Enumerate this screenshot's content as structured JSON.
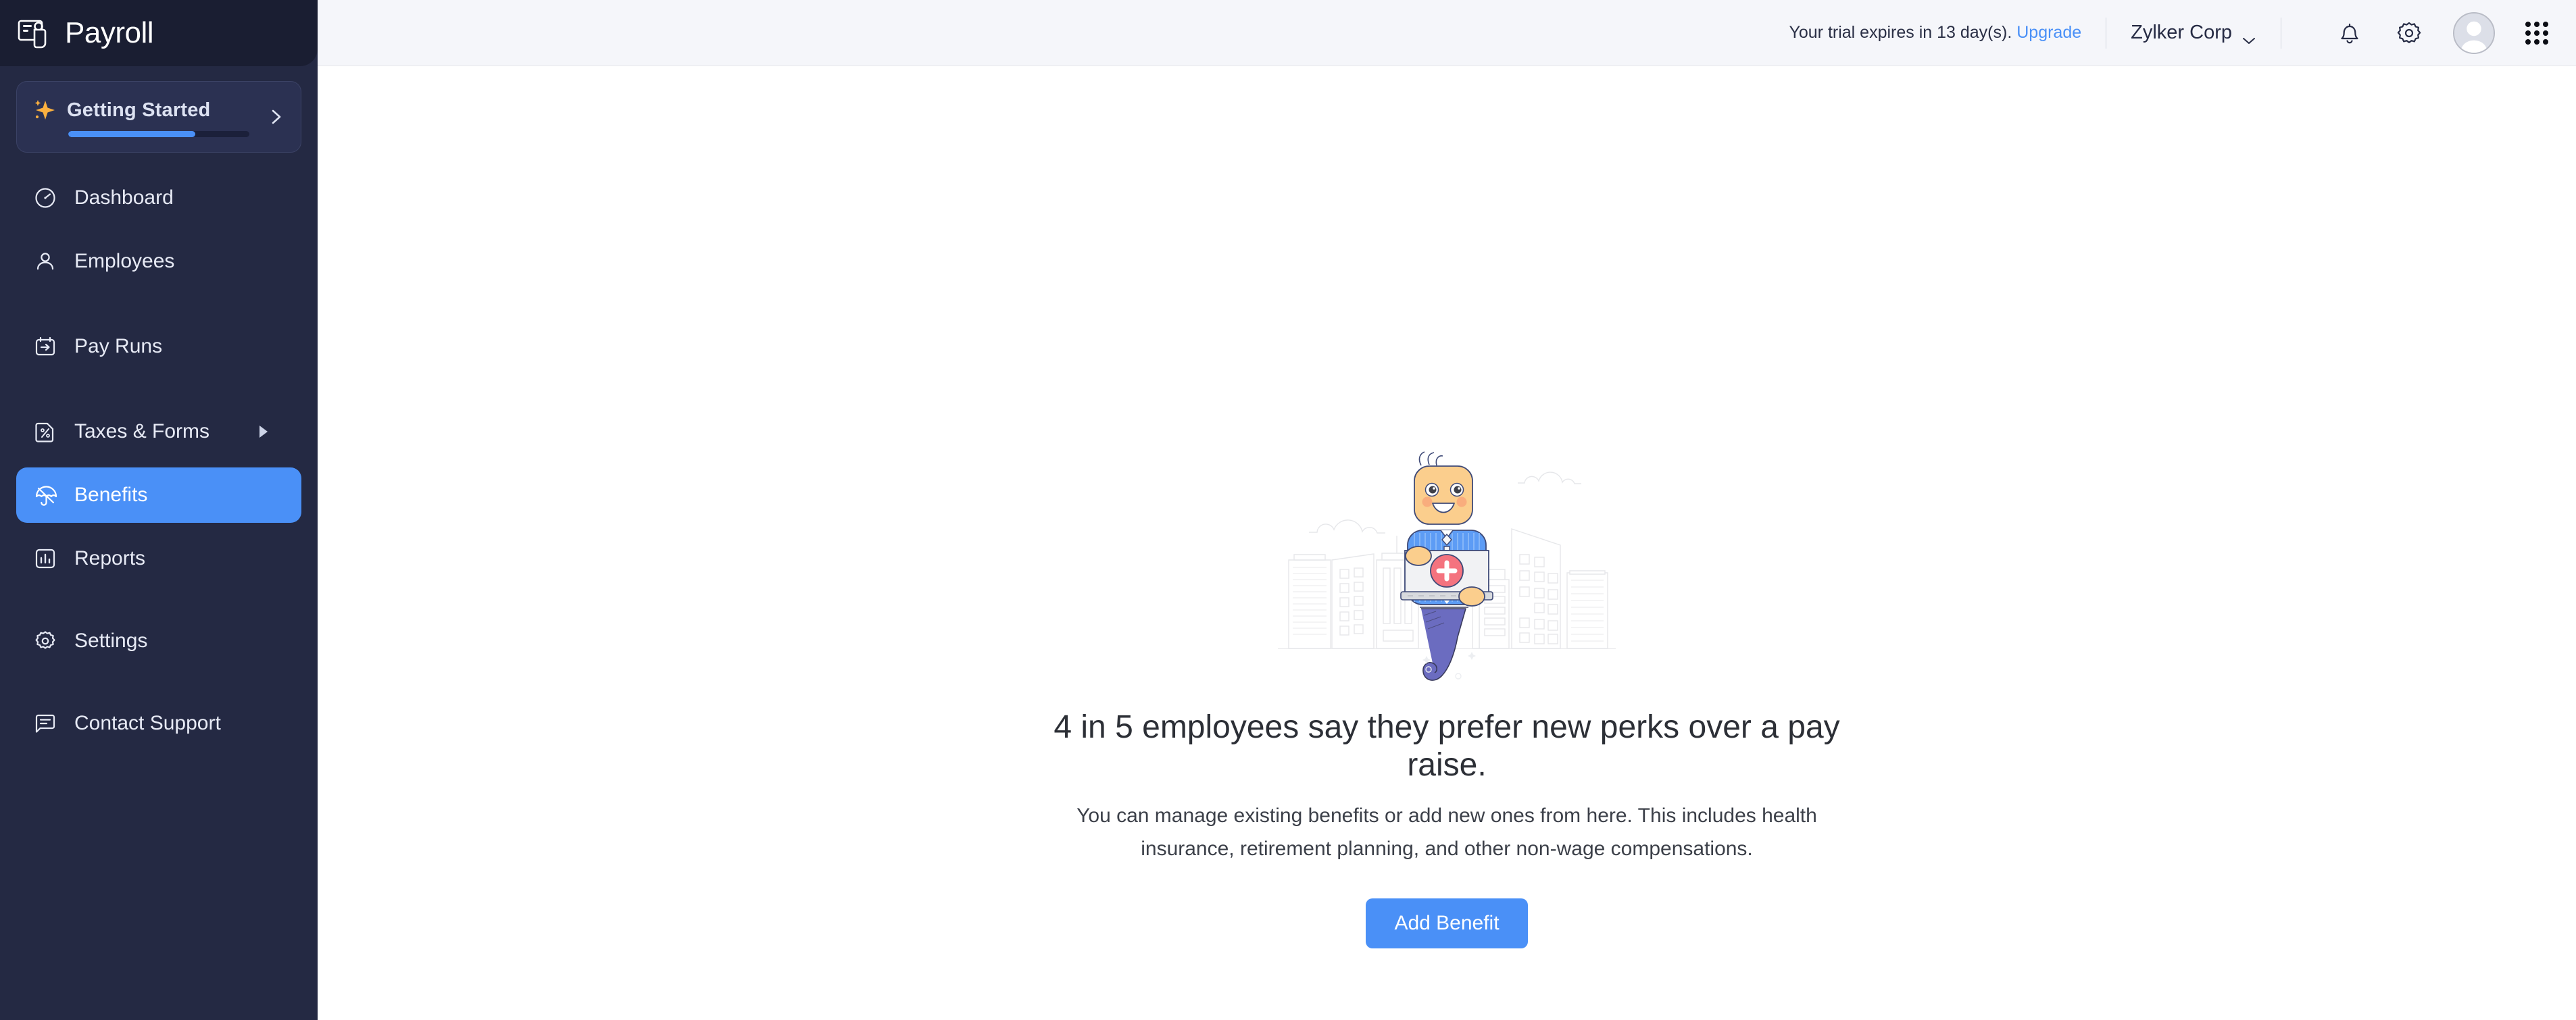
{
  "app": {
    "brand": "Payroll",
    "brand_icon": "payroll-card-icon"
  },
  "sidebar": {
    "getting_started": {
      "label": "Getting Started",
      "icon": "sparkle-icon",
      "chevron_icon": "chevron-right-icon",
      "progress_percent": 70
    },
    "items": [
      {
        "label": "Dashboard",
        "icon": "speedometer-icon",
        "active": false,
        "has_submenu": false
      },
      {
        "label": "Employees",
        "icon": "person-icon",
        "active": false,
        "has_submenu": false
      },
      {
        "label": "Pay Runs",
        "icon": "calendar-arrow-icon",
        "active": false,
        "has_submenu": false
      },
      {
        "label": "Taxes & Forms",
        "icon": "percent-doc-icon",
        "active": false,
        "has_submenu": true
      },
      {
        "label": "Benefits",
        "icon": "umbrella-icon",
        "active": true,
        "has_submenu": false
      },
      {
        "label": "Reports",
        "icon": "bar-chart-icon",
        "active": false,
        "has_submenu": false
      },
      {
        "label": "Settings",
        "icon": "gear-icon",
        "active": false,
        "has_submenu": false
      },
      {
        "label": "Contact Support",
        "icon": "chat-bubble-icon",
        "active": false,
        "has_submenu": false
      }
    ]
  },
  "topbar": {
    "trial_message": "Your trial expires in 13 day(s).",
    "upgrade_label": "Upgrade",
    "organization": "Zylker Corp",
    "org_chevron_icon": "chevron-down-icon",
    "notifications_icon": "bell-icon",
    "settings_icon": "gear-icon",
    "avatar_icon": "user-avatar",
    "apps_icon": "apps-grid-icon"
  },
  "empty_state": {
    "illustration": "benefits-character-umbrella-illustration",
    "headline": "4 in 5 employees say they prefer new perks over a pay raise.",
    "subtext": "You can manage existing benefits or add new ones from here. This includes health insurance, retirement planning, and other non-wage compensations.",
    "cta_label": "Add Benefit"
  },
  "colors": {
    "sidebar_bg": "#242943",
    "sidebar_logo_bg": "#1a1e32",
    "accent": "#4a90f7",
    "topbar_bg": "#f5f6fa",
    "spark": "#fbb040",
    "illustration_face": "#fbce8d",
    "illustration_shirt": "#5d9cf5",
    "illustration_umbrella": "#6b6cc0",
    "illustration_cross": "#f4737f"
  }
}
